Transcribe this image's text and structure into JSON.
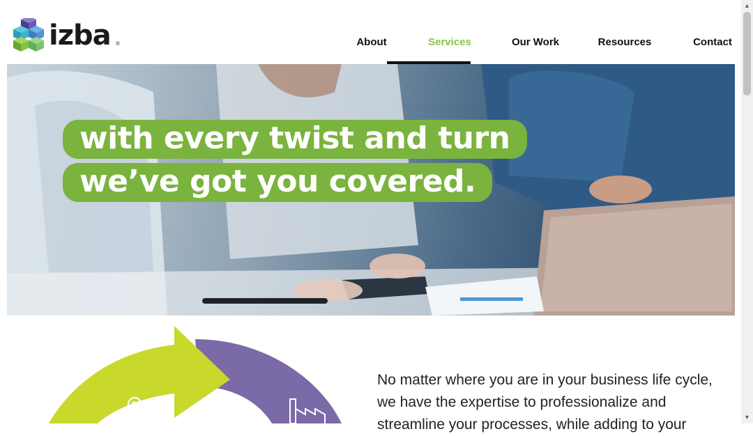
{
  "brand": {
    "name": "izba",
    "reg": "®"
  },
  "nav": {
    "items": [
      {
        "label": "About",
        "active": false
      },
      {
        "label": "Services",
        "active": true
      },
      {
        "label": "Our Work",
        "active": false
      },
      {
        "label": "Resources",
        "active": false
      },
      {
        "label": "Contact",
        "active": false
      }
    ]
  },
  "hero": {
    "line1": "with every twist and turn",
    "line2": "we’ve got you covered."
  },
  "body": {
    "paragraph": "No matter where you are in your business life cycle, we have the expertise to professionalize and streamline your processes, while adding to your"
  },
  "colors": {
    "accent_green": "#7ab33e",
    "nav_active": "#8bc34a",
    "cycle_lime": "#c8d92c",
    "cycle_purple": "#7b6aa8"
  },
  "icons": [
    "dollar-growth-icon",
    "factory-icon"
  ]
}
